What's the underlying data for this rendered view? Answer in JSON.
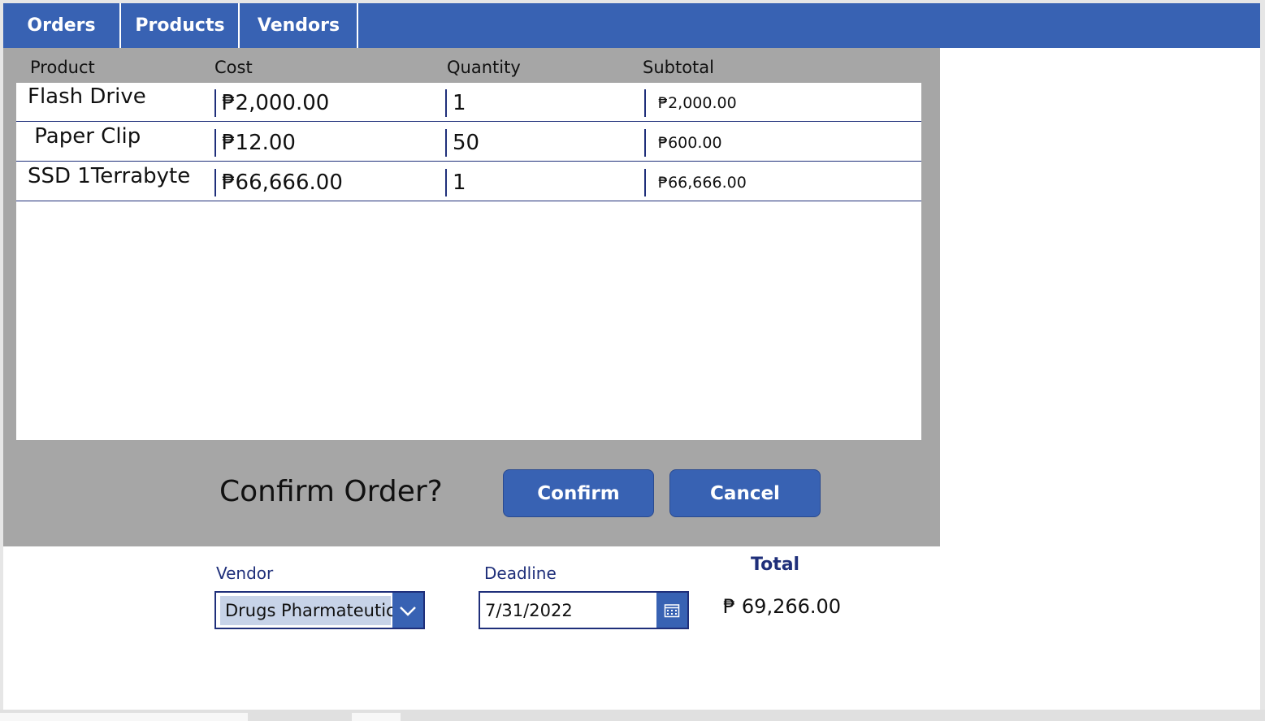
{
  "nav": {
    "tabs": [
      "Orders",
      "Products",
      "Vendors"
    ]
  },
  "table": {
    "headers": [
      "Product",
      "Cost",
      "Quantity",
      "Subtotal"
    ],
    "rows": [
      {
        "product": "Flash Drive",
        "cost": "₱2,000.00",
        "quantity": "1",
        "subtotal": "₱2,000.00"
      },
      {
        "product": " Paper Clip",
        "cost": "₱12.00",
        "quantity": "50",
        "subtotal": "₱600.00"
      },
      {
        "product": "SSD 1Terrabyte",
        "cost": "₱66,666.00",
        "quantity": "1",
        "subtotal": "₱66,666.00"
      }
    ]
  },
  "modal": {
    "question": "Confirm Order?",
    "confirm_label": "Confirm",
    "cancel_label": "Cancel"
  },
  "form": {
    "vendor_label": "Vendor",
    "vendor_value": "Drugs Pharmateutical",
    "deadline_label": "Deadline",
    "deadline_value": "7/31/2022",
    "total_label": "Total",
    "total_value": "₱ 69,266.00"
  },
  "colors": {
    "accent": "#3862b3",
    "dark_navy": "#1f2f7a",
    "modal_gray": "#a6a6a6"
  },
  "icons": {
    "dropdown": "chevron-down-icon",
    "datepicker": "calendar-icon"
  }
}
